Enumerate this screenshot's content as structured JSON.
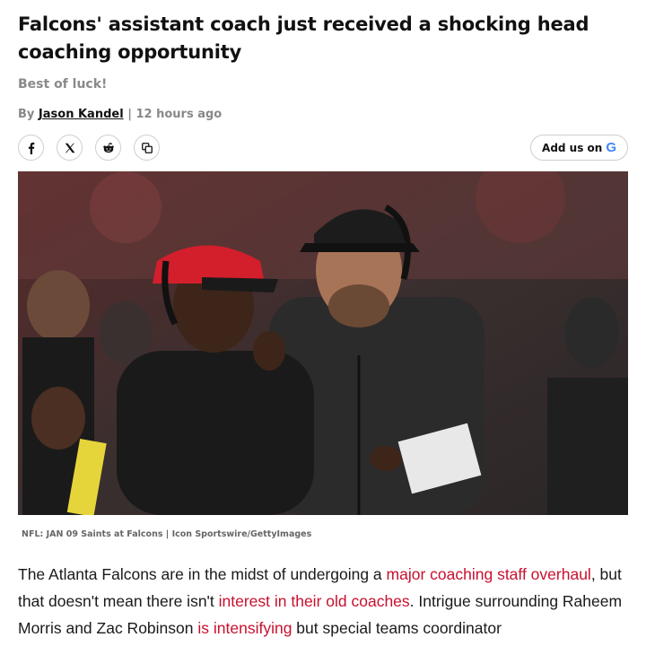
{
  "article": {
    "headline": "Falcons' assistant coach just received a shocking head coaching opportunity",
    "subhead": "Best of luck!",
    "byline_prefix": "By ",
    "author": "Jason Kandel",
    "byline_separator": " | ",
    "timestamp": "12 hours ago"
  },
  "share": {
    "buttons": [
      {
        "icon": "facebook-icon"
      },
      {
        "icon": "x-icon"
      },
      {
        "icon": "reddit-icon"
      },
      {
        "icon": "copy-link-icon"
      }
    ],
    "add_us_label": "Add us on",
    "google_glyph": "G"
  },
  "photo": {
    "caption": "NFL: JAN 09 Saints at Falcons | Icon Sportswire/GettyImages"
  },
  "body": {
    "seg1": "The Atlanta Falcons are in the midst of undergoing a ",
    "link1": "major coaching staff overhaul",
    "seg2": ", but that doesn't mean there isn't ",
    "link2": "interest in their old coaches",
    "seg3": ". Intrigue surrounding Raheem Morris and Zac Robinson ",
    "link3": "is intensifying",
    "seg4": " but special teams coordinator"
  },
  "colors": {
    "link": "#c8102e",
    "muted": "#888888",
    "falcons_red": "#d21f2b"
  }
}
